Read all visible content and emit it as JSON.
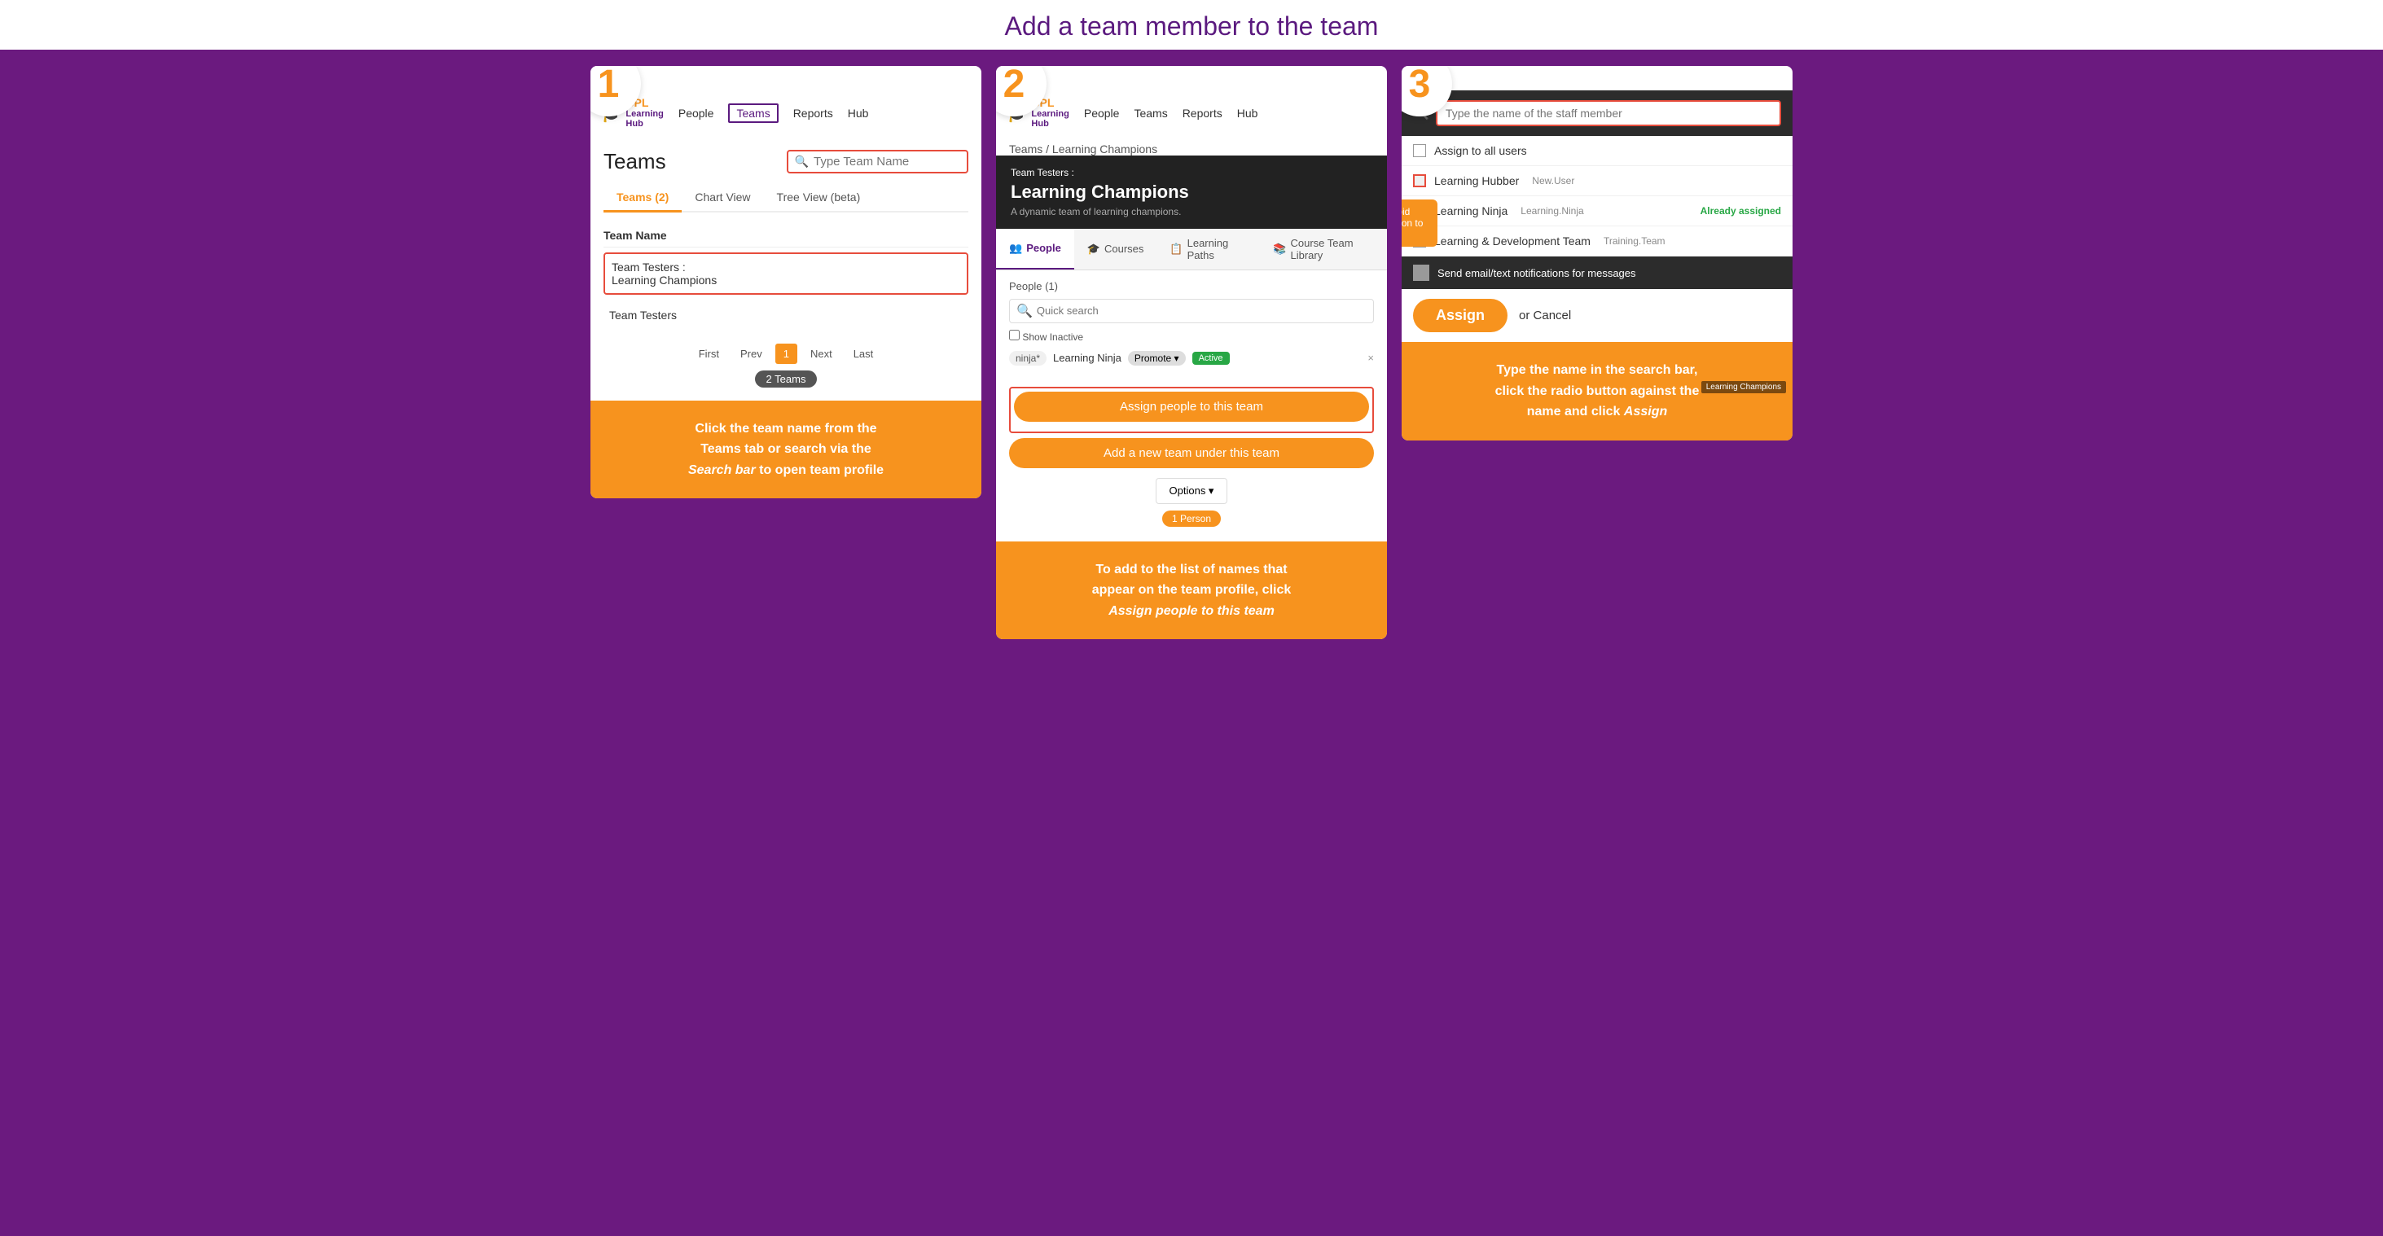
{
  "page": {
    "title": "Add a team member to the team"
  },
  "card1": {
    "step": "1",
    "nav": {
      "logo_cpl": "CPL",
      "logo_learning": "Learning",
      "logo_hub": "Hub",
      "items": [
        "People",
        "Teams",
        "Reports",
        "Hub"
      ],
      "active_item": "Teams"
    },
    "teams_title": "Teams",
    "search_placeholder": "Type Team Name",
    "tabs": [
      "Teams (2)",
      "Chart View",
      "Tree View (beta)"
    ],
    "active_tab": "Teams (2)",
    "table_header": "Team Name",
    "rows": [
      {
        "name": "Team Testers :\nLearning Champions",
        "highlighted": true
      },
      {
        "name": "Team Testers",
        "highlighted": false
      }
    ],
    "pagination": {
      "first": "First",
      "prev": "Prev",
      "current": "1",
      "next": "Next",
      "last": "Last"
    },
    "count_label": "2 Teams",
    "footer": "Click the team name from the Teams tab or search via the Search bar to open team profile"
  },
  "card2": {
    "step": "2",
    "nav": {
      "logo_cpl": "CPL",
      "logo_learning": "Learning",
      "logo_hub": "Hub",
      "items": [
        "People",
        "Teams",
        "Reports",
        "Hub"
      ]
    },
    "breadcrumb": "Teams / Learning Champions",
    "profile_header": {
      "breadcrumb_team": "Team Testers :",
      "team_name": "Learning Champions",
      "subtitle": "A dynamic team of learning champions."
    },
    "profile_tabs": [
      "People",
      "Courses",
      "Learning Paths",
      "Course Team Library"
    ],
    "people_section": {
      "label": "People (1)",
      "search_placeholder": "Quick search",
      "show_inactive": "Show Inactive",
      "person": {
        "name": "Learning Ninja",
        "badge": "ninja*",
        "promote_label": "Promote ▾",
        "status": "Active",
        "remove": "×"
      }
    },
    "assign_btn": "Assign people to this team",
    "add_team_btn": "Add a new team under this team",
    "options_btn": "Options ▾",
    "person_count": "1 Person",
    "footer": "To add to the list of names that appear on the team profile, click Assign people to this team"
  },
  "card3": {
    "step": "3",
    "search_placeholder": "Type the name of the staff member",
    "users": [
      {
        "name": "Assign to all users",
        "login": "",
        "type": "assign-all",
        "checked": false
      },
      {
        "name": "Learning Hubber",
        "login": "New.User",
        "type": "radio",
        "checked": true,
        "already": false
      },
      {
        "name": "Learning Ninja",
        "login": "Learning.Ninja",
        "type": "checkbox",
        "checked": false,
        "already": true,
        "already_label": "Already assigned"
      },
      {
        "name": "Learning & Development Team",
        "login": "Training.Team",
        "type": "checkbox",
        "checked": false,
        "already": false
      }
    ],
    "tooltip": "Untick checkbox to avoid sending an email notification to staff",
    "notification_label": "Send email/text notifications for messages",
    "assign_btn": "Assign",
    "cancel_label": "or Cancel",
    "lc_tag": "Learning Champions",
    "footer": "Type the name in the search bar, click the radio button against the name and click Assign"
  }
}
